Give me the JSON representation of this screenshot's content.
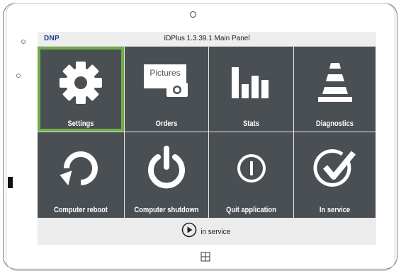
{
  "header": {
    "brand": "DNP",
    "title": "IDPlus 1.3.39.1 Main Panel"
  },
  "tiles": [
    {
      "label": "Settings",
      "icon": "gear-icon",
      "selected": true
    },
    {
      "label": "Orders",
      "icon": "pictures-icon",
      "icon_text": "Pictures"
    },
    {
      "label": "Stats",
      "icon": "bar-chart-icon"
    },
    {
      "label": "Diagnostics",
      "icon": "traffic-cone-icon"
    },
    {
      "label": "Computer reboot",
      "icon": "reboot-icon"
    },
    {
      "label": "Computer shutdown",
      "icon": "power-icon"
    },
    {
      "label": "Quit application",
      "icon": "quit-icon"
    },
    {
      "label": "In service",
      "icon": "checkmark-icon"
    }
  ],
  "footer": {
    "label": "in service",
    "icon": "play-circle-icon"
  },
  "colors": {
    "tile_background": "#4a4f54",
    "selected_border": "#6fad4a",
    "brand": "#1b3f8f"
  }
}
